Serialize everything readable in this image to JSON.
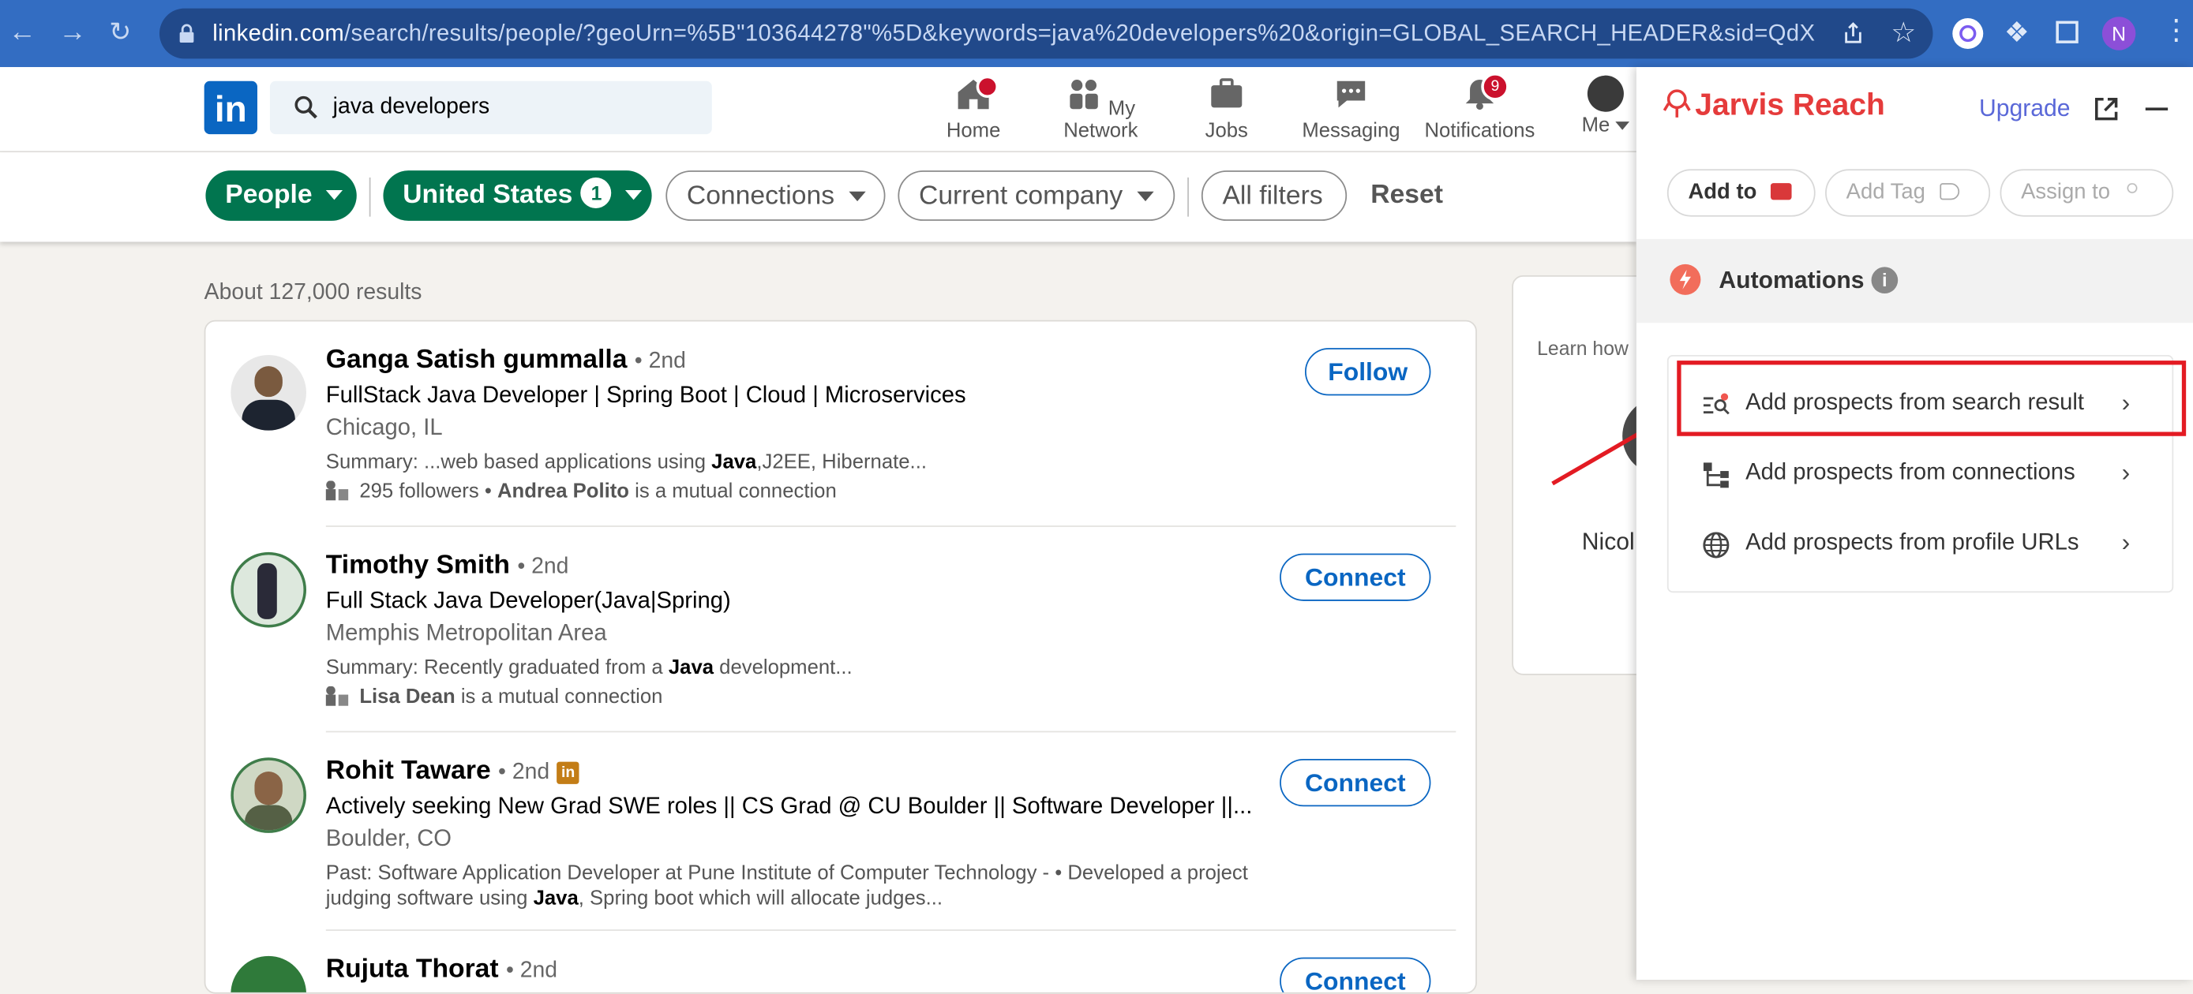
{
  "browser": {
    "url_host": "linkedin.com",
    "url_path": "/search/results/people/?geoUrn=%5B\"103644278\"%5D&keywords=java%20developers%20&origin=GLOBAL_SEARCH_HEADER&sid=QdX",
    "profile_initial": "N"
  },
  "linkedin": {
    "logo": "in",
    "search_value": "java developers",
    "nav": [
      {
        "label": "Home"
      },
      {
        "label": "My Network"
      },
      {
        "label": "Jobs"
      },
      {
        "label": "Messaging"
      },
      {
        "label": "Notifications",
        "badge": "9"
      },
      {
        "label": "Me"
      }
    ],
    "filters": {
      "people": "People",
      "location": "United States",
      "location_count": "1",
      "connections": "Connections",
      "company": "Current company",
      "all": "All filters",
      "reset": "Reset"
    },
    "results_count": "About 127,000 results",
    "right_card_text": "Learn how",
    "right_card_name": "Nicol",
    "results": [
      {
        "name": "Ganga Satish gummalla",
        "degree": "• 2nd",
        "headline": "FullStack Java Developer | Spring Boot | Cloud | Microservices",
        "location": "Chicago, IL",
        "summary_pre": "Summary: ...web based applications using ",
        "summary_bold": "Java",
        "summary_post": ",J2EE, Hibernate...",
        "meta_pre": "295 followers • ",
        "meta_bold": "Andrea Polito",
        "meta_post": " is a mutual connection",
        "action": "Follow"
      },
      {
        "name": "Timothy Smith",
        "degree": "• 2nd",
        "headline": "Full Stack Java Developer(Java|Spring)",
        "location": "Memphis Metropolitan Area",
        "summary_pre": "Summary: Recently graduated from a ",
        "summary_bold": "Java",
        "summary_post": " development...",
        "meta_pre": "",
        "meta_bold": "Lisa Dean",
        "meta_post": " is a mutual connection",
        "action": "Connect"
      },
      {
        "name": "Rohit Taware",
        "degree": "• 2nd",
        "headline": "Actively seeking New Grad SWE roles || CS Grad @ CU Boulder || Software Developer ||...",
        "location": "Boulder, CO",
        "summary_line1": "Past: Software Application Developer at Pune Institute of Computer Technology - • Developed a project",
        "summary_pre": "judging software using ",
        "summary_bold": "Java",
        "summary_post": ", Spring boot which will allocate judges...",
        "action": "Connect"
      },
      {
        "name": "Rujuta Thorat",
        "degree": "• 2nd",
        "action": "Connect"
      }
    ]
  },
  "jarvis": {
    "brand": "Jarvis Reach",
    "upgrade": "Upgrade",
    "add_to": "Add to",
    "add_tag": "Add Tag",
    "assign_to": "Assign to",
    "automations": "Automations",
    "options": [
      {
        "label": "Add prospects from search result"
      },
      {
        "label": "Add prospects from connections"
      },
      {
        "label": "Add prospects from profile URLs"
      }
    ],
    "accent_color": "#e31b23"
  }
}
